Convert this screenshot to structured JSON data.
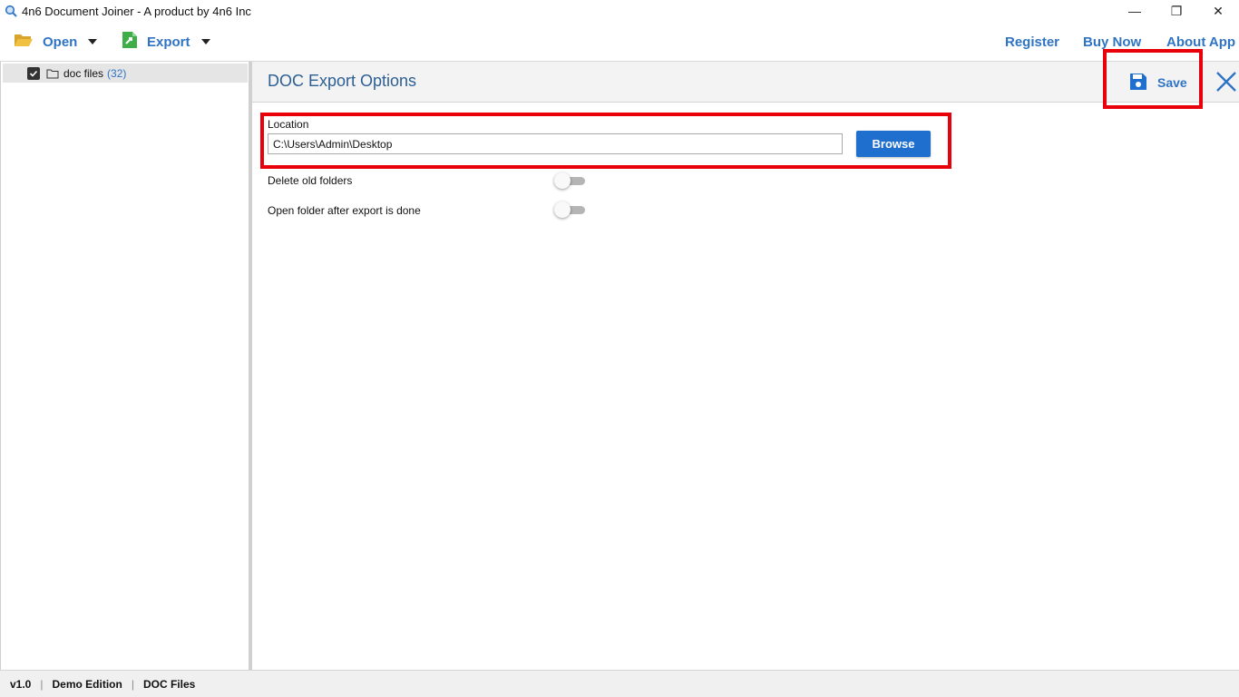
{
  "window": {
    "title": "4n6 Document Joiner - A product by 4n6 Inc",
    "minimize_glyph": "—",
    "restore_glyph": "❐",
    "close_glyph": "✕"
  },
  "toolbar": {
    "open_label": "Open",
    "export_label": "Export",
    "register_label": "Register",
    "buy_now_label": "Buy Now",
    "about_label": "About App"
  },
  "sidebar": {
    "items": [
      {
        "label": "doc files",
        "count": "(32)",
        "checked": true
      }
    ]
  },
  "panel": {
    "title": "DOC Export Options",
    "save_label": "Save",
    "location_label": "Location",
    "location_value": "C:\\Users\\Admin\\Desktop",
    "browse_label": "Browse",
    "options": [
      {
        "label": "Delete old folders",
        "enabled": false
      },
      {
        "label": "Open folder after export is done",
        "enabled": false
      }
    ]
  },
  "status": {
    "version": "v1.0",
    "edition": "Demo Edition",
    "mode": "DOC Files",
    "separator": "|"
  },
  "colors": {
    "accent": "#2f74c4",
    "button_primary": "#1f6fcf",
    "highlight": "#e8000b",
    "title_text": "#2c5f94"
  }
}
